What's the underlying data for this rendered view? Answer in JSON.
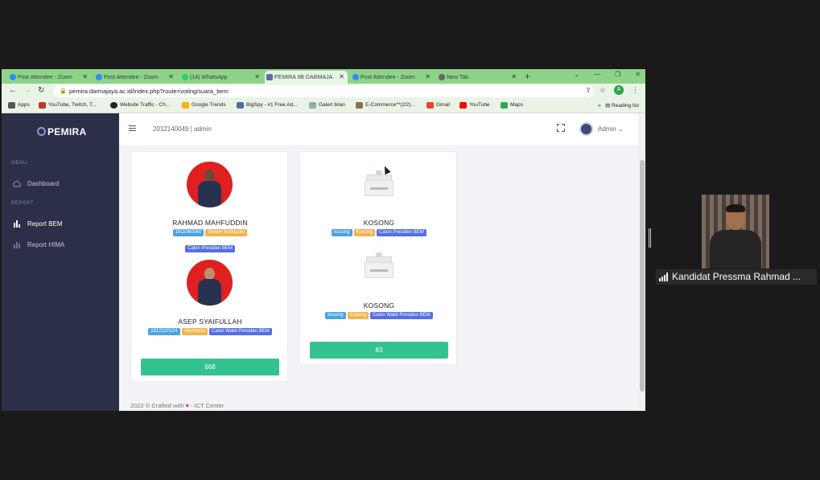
{
  "browser": {
    "tabs": [
      {
        "title": "Post Attendee - Zoom",
        "icon": "zoom-icon"
      },
      {
        "title": "Post Attendee - Zoom",
        "icon": "zoom-icon"
      },
      {
        "title": "(14) WhatsApp",
        "icon": "whatsapp-icon"
      },
      {
        "title": "PEMIRA IIB DARMAJA",
        "icon": "pemira-icon",
        "active": true
      },
      {
        "title": "Post Attendee - Zoom",
        "icon": "zoom-icon"
      },
      {
        "title": "New Tab",
        "icon": "chrome-icon"
      }
    ],
    "url": "pemira.darmajaya.ac.id/index.php?route=voting/suara_bem",
    "profile_initial": "A",
    "bookmarks": [
      "Apps",
      "YouTube, Twitch, T...",
      "Website Traffic - Ch...",
      "Google Trends",
      "BigSpy - #1 Free Ad...",
      "Galeri Iklan",
      "E-Commerce**(2/2)...",
      "Gmail",
      "YouTube",
      "Maps"
    ],
    "reading_list": "Reading list"
  },
  "app": {
    "brand": "PEMIRA",
    "menu_head": "MENU",
    "report_head": "REPORT",
    "menu_items": [
      "Dashboard",
      "Report BEM",
      "Report HIMA"
    ],
    "user_id": "2012140049 | admin",
    "admin_label": "Admin"
  },
  "cards": [
    {
      "candidates": [
        {
          "name": "RAHMAD MAHFUDDIN",
          "badges": [
            "1911060060",
            "Sistem Komputer",
            "Calon Presiden BEM"
          ]
        },
        {
          "name": "ASEP SYAIFULLAH",
          "badges": [
            "1912120124",
            "Akuntansi",
            "Calon Wakil Presiden BEM"
          ]
        }
      ],
      "votes": "668"
    },
    {
      "candidates": [
        {
          "name": "KOSONG",
          "badges": [
            "kosong",
            "Kosong",
            "Calon Presiden BEM"
          ]
        },
        {
          "name": "KOSONG",
          "badges": [
            "kosong",
            "Kosong",
            "Calon Wakil Presiden BEM"
          ]
        }
      ],
      "votes": "83"
    }
  ],
  "footer": {
    "prefix": "2022 © Crafted with",
    "suffix": "- ICT Center"
  },
  "zoom": {
    "participant_name": "Kandidat Pressma Rahmad ..."
  },
  "colors": {
    "tab_bg": "#8fd38a",
    "sidebar": "#2c2f48",
    "vote_button": "#34c38f",
    "badge_blue": "#4aa3df",
    "badge_orange": "#f1b44c",
    "badge_indigo": "#556ee6"
  }
}
